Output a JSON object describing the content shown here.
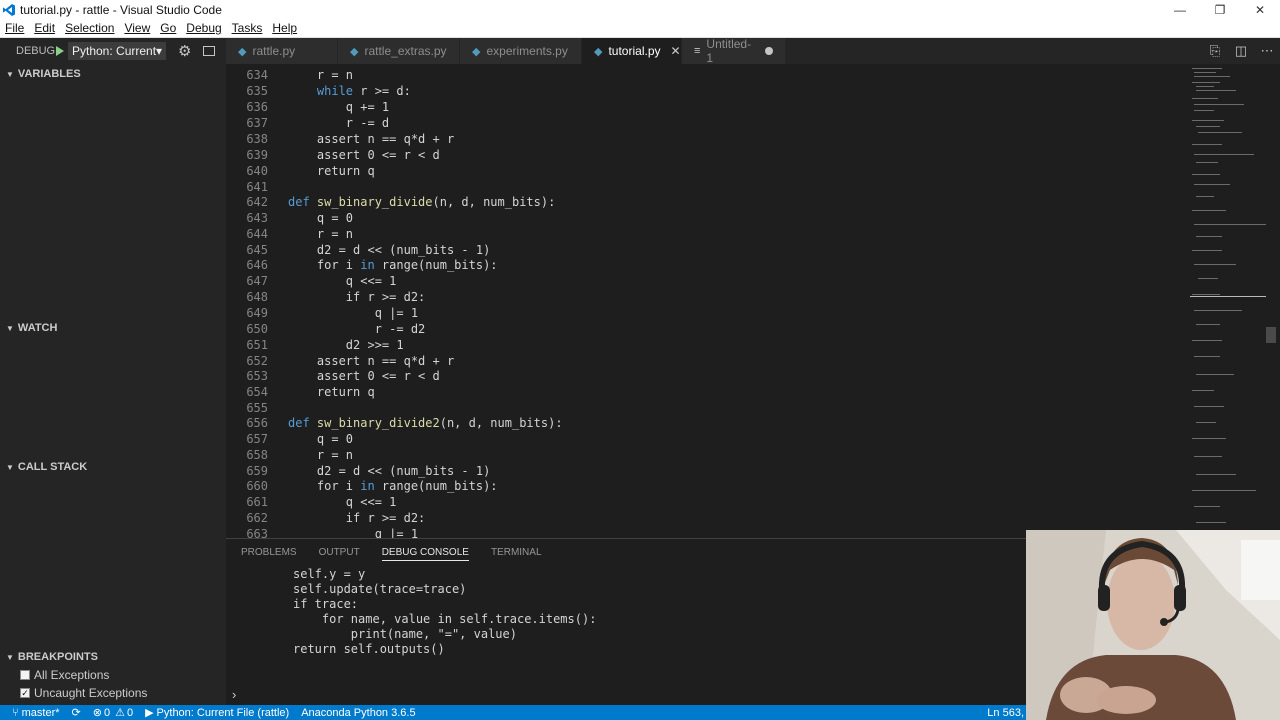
{
  "window": {
    "title": "tutorial.py - rattle - Visual Studio Code",
    "minimize": "—",
    "restore": "❐",
    "close": "✕"
  },
  "menu": [
    "File",
    "Edit",
    "Selection",
    "View",
    "Go",
    "Debug",
    "Tasks",
    "Help"
  ],
  "debug": {
    "title": "DEBUG",
    "config": "Python: Current",
    "dropdown": "▾"
  },
  "tabs": [
    {
      "label": "rattle.py"
    },
    {
      "label": "rattle_extras.py"
    },
    {
      "label": "experiments.py"
    },
    {
      "label": "tutorial.py",
      "close": "✕"
    },
    {
      "label": "Untitled-1"
    }
  ],
  "sidebar": {
    "variables": "VARIABLES",
    "watch": "WATCH",
    "call_stack": "CALL STACK",
    "breakpoints": "BREAKPOINTS",
    "bp_items": [
      {
        "label": "All Exceptions",
        "checked": false
      },
      {
        "label": "Uncaught Exceptions",
        "checked": true
      }
    ],
    "chev_open": "▼",
    "check": "✓"
  },
  "code": {
    "l634": {
      "n": "634",
      "t": "    r = n"
    },
    "l635": {
      "n": "635",
      "a": "    ",
      "b": "while",
      "c": " r >= d:"
    },
    "l636": {
      "n": "636",
      "t": "        q += 1"
    },
    "l637": {
      "n": "637",
      "t": "        r -= d"
    },
    "l638": {
      "n": "638",
      "t": "    assert n == q*d + r"
    },
    "l639": {
      "n": "639",
      "t": "    assert 0 <= r < d"
    },
    "l640": {
      "n": "640",
      "t": "    return q"
    },
    "l641": {
      "n": "641",
      "t": ""
    },
    "l642": {
      "n": "642",
      "a": "def ",
      "b": "sw_binary_divide",
      "c": "(n, d, num_bits):"
    },
    "l643": {
      "n": "643",
      "t": "    q = 0"
    },
    "l644": {
      "n": "644",
      "t": "    r = n"
    },
    "l645": {
      "n": "645",
      "t": "    d2 = d << (num_bits - 1)"
    },
    "l646": {
      "n": "646",
      "a": "    for i ",
      "b": "in",
      "c": " range(num_bits):"
    },
    "l647": {
      "n": "647",
      "t": "        q <<= 1"
    },
    "l648": {
      "n": "648",
      "t": "        if r >= d2:"
    },
    "l649": {
      "n": "649",
      "t": "            q |= 1"
    },
    "l650": {
      "n": "650",
      "t": "            r -= d2"
    },
    "l651": {
      "n": "651",
      "t": "        d2 >>= 1"
    },
    "l652": {
      "n": "652",
      "t": "    assert n == q*d + r"
    },
    "l653": {
      "n": "653",
      "t": "    assert 0 <= r < d"
    },
    "l654": {
      "n": "654",
      "t": "    return q"
    },
    "l655": {
      "n": "655",
      "t": ""
    },
    "l656": {
      "n": "656",
      "a": "def ",
      "b": "sw_binary_divide2",
      "c": "(n, d, num_bits):"
    },
    "l657": {
      "n": "657",
      "t": "    q = 0"
    },
    "l658": {
      "n": "658",
      "t": "    r = n"
    },
    "l659": {
      "n": "659",
      "t": "    d2 = d << (num_bits - 1)"
    },
    "l660": {
      "n": "660",
      "a": "    for i ",
      "b": "in",
      "c": " range(num_bits):"
    },
    "l661": {
      "n": "661",
      "t": "        q <<= 1"
    },
    "l662": {
      "n": "662",
      "t": "        if r >= d2:"
    },
    "l663": {
      "n": "663",
      "t": "            q |= 1"
    }
  },
  "panel": {
    "tabs": [
      "PROBLEMS",
      "OUTPUT",
      "DEBUG CONSOLE",
      "TERMINAL"
    ],
    "active_tab": "DEBUG CONSOLE",
    "lines": [
      "self.y = y",
      "self.update(trace=trace)",
      "if trace:",
      "    for name, value in self.trace.items():",
      "        print(name, \"=\", value)",
      "return self.outputs()"
    ],
    "prompt": "›"
  },
  "status": {
    "branch": "master*",
    "sync": "⟳",
    "errors": "0",
    "warnings": "0",
    "debug_config": "Python: Current File (rattle)",
    "interpreter": "Anaconda Python 3.6.5",
    "position": "Ln 563,"
  },
  "colors": {
    "accent": "#007acc",
    "keyword": "#569cd6",
    "function": "#dcdcaa"
  }
}
